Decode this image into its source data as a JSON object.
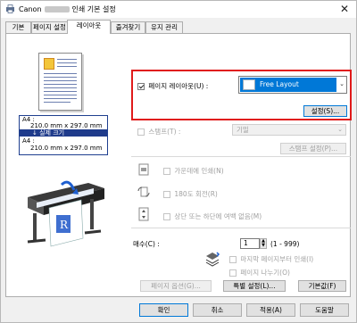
{
  "window": {
    "title_prefix": "Canon",
    "title_suffix": "인쇄 기본 설정",
    "close_glyph": "✕"
  },
  "tabs": [
    {
      "label": "기본"
    },
    {
      "label": "페이지 설정"
    },
    {
      "label": "레이아웃"
    },
    {
      "label": "즐겨찾기"
    },
    {
      "label": "유지 관리"
    }
  ],
  "preview": {
    "size_line1_label": "A4 :",
    "size_line1_value": "210.0 mm x 297.0 mm",
    "band_label": "↓ 실제 크기",
    "size_line2_label": "A4 :",
    "size_line2_value": "210.0 mm x 297.0 mm"
  },
  "page_layout": {
    "checkbox_label": "페이지 레이아웃(U) :",
    "checked": true,
    "selected_value": "Free Layout",
    "settings_button": "설정(S)..."
  },
  "stamp": {
    "checkbox_label": "스탬프(T) :",
    "combo_value": "기밀",
    "settings_button": "스탬프 설정(P)..."
  },
  "options": {
    "center_label": "가운데에 인쇄(N)",
    "rotate_label": "180도 회전(R)",
    "no_margin_label": "상단 또는 하단에 여백 없음(M)"
  },
  "copies": {
    "label": "매수(C) :",
    "value": "1",
    "range": "(1 - 999)",
    "last_page_first_label": "마지막 페이지부터 인쇄(I)",
    "collate_label": "페이지 나누기(O)"
  },
  "panel_buttons": {
    "page_options": "페이지 옵션(G)...",
    "special_settings": "특별 설정(L)...",
    "defaults": "기본값(F)"
  },
  "dialog_buttons": {
    "ok": "확인",
    "cancel": "취소",
    "apply": "적용(A)",
    "help": "도움말"
  },
  "colors": {
    "accent": "#0078d7",
    "highlight_box": "#e01a1a",
    "size_band": "#1f3b8b"
  }
}
